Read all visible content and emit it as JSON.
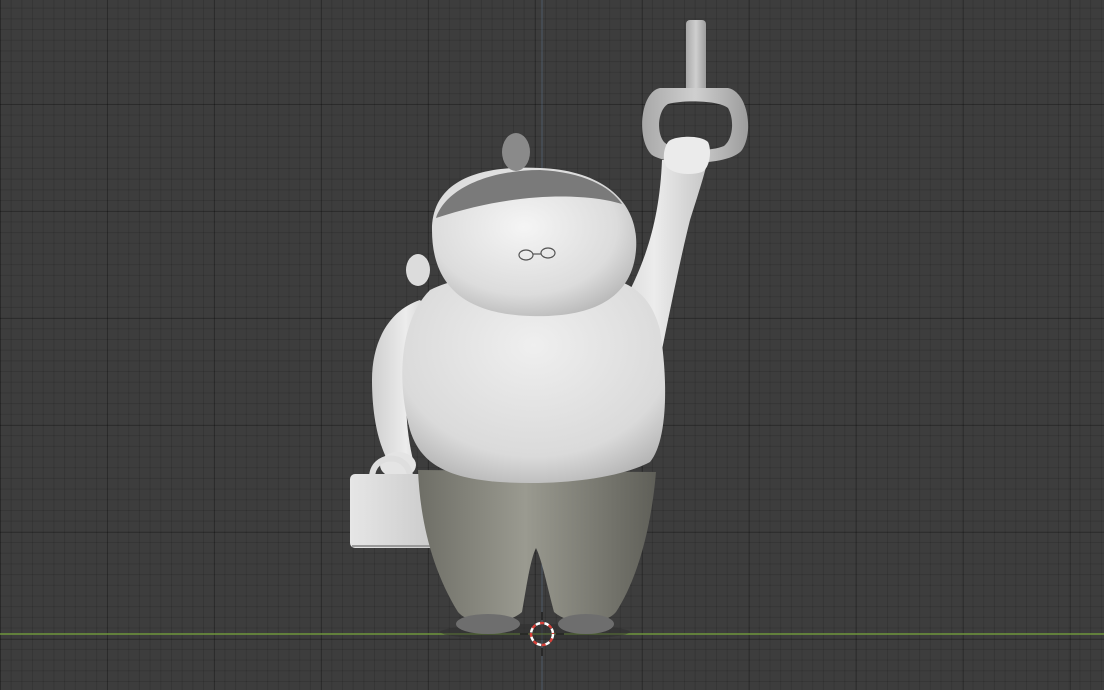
{
  "viewport": {
    "background_color": "#3d3d3d",
    "x_axis_color": "#7aa83d",
    "y_axis_color": "#6b8fb3"
  },
  "model": {
    "body_color": "#e8e8e8",
    "pants_color": "#8a8a80",
    "hair_color": "#7a7a7a",
    "shoe_color": "#6e6e6e"
  },
  "icons": {
    "cursor": "3d-cursor-icon"
  }
}
